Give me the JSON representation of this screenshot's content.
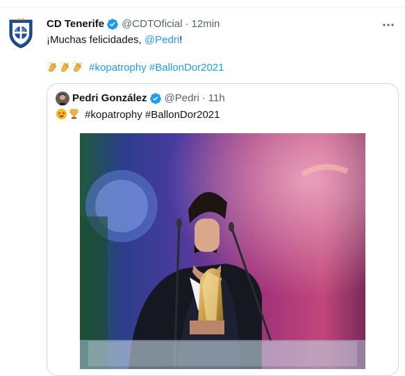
{
  "tweet": {
    "author_name": "CD Tenerife",
    "handle": "@CDTOficial",
    "separator": "·",
    "time": "12min",
    "line1_prefix": "¡Muchas felicidades, ",
    "line1_mention": "@Pedri",
    "line1_suffix": "!",
    "emojis": [
      "clapping-hands",
      "clapping-hands",
      "clapping-hands"
    ],
    "hashtags": [
      "#kopatrophy",
      "#BallonDor2021"
    ],
    "logo_letters": "C D T"
  },
  "quote": {
    "author_name": "Pedri González",
    "handle": "@Pedri",
    "separator": "·",
    "time": "11h",
    "emojis": [
      "star-struck-face",
      "trophy"
    ],
    "text": "#kopatrophy #BallonDor2021"
  },
  "colors": {
    "link": "#1d9bf0",
    "verified": "#1d9bf0",
    "muted": "#536471",
    "border": "#cfd9de"
  }
}
